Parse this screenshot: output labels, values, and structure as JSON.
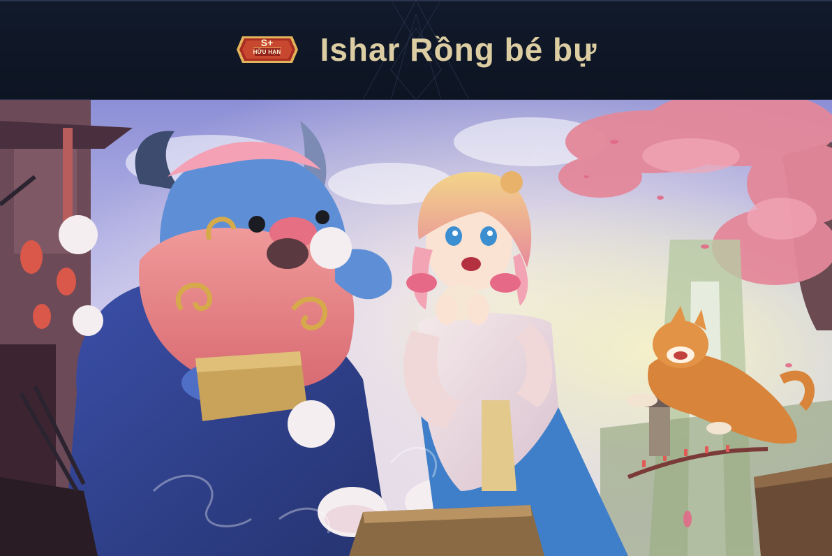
{
  "skin": {
    "name": "Ishar Rồng bé bự",
    "tier": "S+",
    "tier_label": "HỮU HẠN"
  },
  "colors": {
    "title": "#dccda3",
    "header_bg": "#111a2b",
    "badge_red": "#c0392b",
    "badge_gold": "#e2b35a"
  },
  "icons": {
    "badge": "tier-badge-icon"
  }
}
